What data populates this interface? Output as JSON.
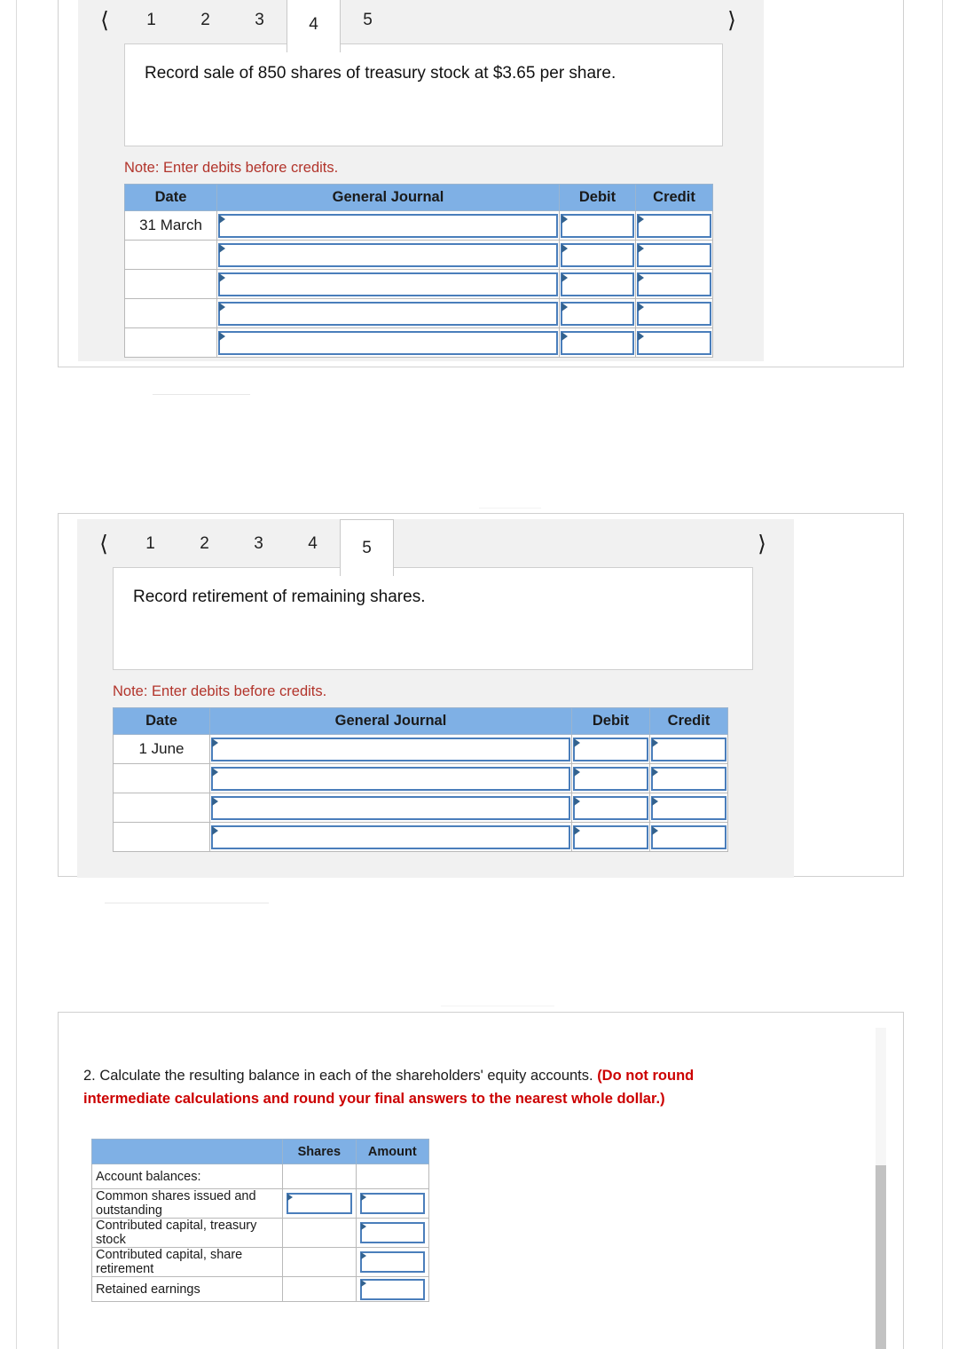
{
  "panels": [
    {
      "id": "panel-tab-4",
      "nav": {
        "prev_icon": "chevron-left-icon",
        "next_icon": "chevron-right-icon",
        "tabs": [
          "1",
          "2",
          "3",
          "4",
          "5"
        ],
        "active": "4"
      },
      "prompt": "Record sale of 850 shares of treasury stock at $3.65 per share.",
      "note": "Note: Enter debits before credits.",
      "journal": {
        "headers": [
          "Date",
          "General Journal",
          "Debit",
          "Credit"
        ],
        "rows": [
          {
            "date": "31 March",
            "journal": "",
            "debit": "",
            "credit": ""
          },
          {
            "date": "",
            "journal": "",
            "debit": "",
            "credit": ""
          },
          {
            "date": "",
            "journal": "",
            "debit": "",
            "credit": ""
          },
          {
            "date": "",
            "journal": "",
            "debit": "",
            "credit": ""
          },
          {
            "date": "",
            "journal": "",
            "debit": "",
            "credit": ""
          }
        ]
      }
    },
    {
      "id": "panel-tab-5",
      "nav": {
        "prev_icon": "chevron-left-icon",
        "next_icon": "chevron-right-icon",
        "tabs": [
          "1",
          "2",
          "3",
          "4",
          "5"
        ],
        "active": "5"
      },
      "prompt": "Record retirement of remaining shares.",
      "note": "Note: Enter debits before credits.",
      "journal": {
        "headers": [
          "Date",
          "General Journal",
          "Debit",
          "Credit"
        ],
        "rows": [
          {
            "date": "1 June",
            "journal": "",
            "debit": "",
            "credit": ""
          },
          {
            "date": "",
            "journal": "",
            "debit": "",
            "credit": ""
          },
          {
            "date": "",
            "journal": "",
            "debit": "",
            "credit": ""
          },
          {
            "date": "",
            "journal": "",
            "debit": "",
            "credit": ""
          }
        ]
      }
    }
  ],
  "question2": {
    "lead": "2. Calculate the resulting balance in each of the shareholders' equity accounts. ",
    "emphasis": "(Do not round intermediate calculations and round your final answers to the nearest whole dollar.)",
    "table": {
      "headers": [
        "",
        "Shares",
        "Amount"
      ],
      "rows": [
        {
          "label": "Account balances:",
          "indent": false,
          "shares_input": false,
          "amount_input": false,
          "shares": "",
          "amount": ""
        },
        {
          "label": "Common shares issued and outstanding",
          "indent": true,
          "shares_input": true,
          "amount_input": true,
          "shares": "",
          "amount": ""
        },
        {
          "label": "Contributed capital, treasury stock",
          "indent": true,
          "shares_input": false,
          "amount_input": true,
          "shares": "",
          "amount": ""
        },
        {
          "label": "Contributed capital, share retirement",
          "indent": true,
          "shares_input": false,
          "amount_input": true,
          "shares": "",
          "amount": ""
        },
        {
          "label": "Retained earnings",
          "indent": true,
          "shares_input": false,
          "amount_input": true,
          "shares": "",
          "amount": ""
        }
      ]
    }
  },
  "colors": {
    "header_blue": "#7fb0e5",
    "input_border_blue": "#4a7ebb",
    "note_red": "#b2342b",
    "emphasis_red": "#cc0000",
    "panel_gray": "#f1f1f1"
  }
}
